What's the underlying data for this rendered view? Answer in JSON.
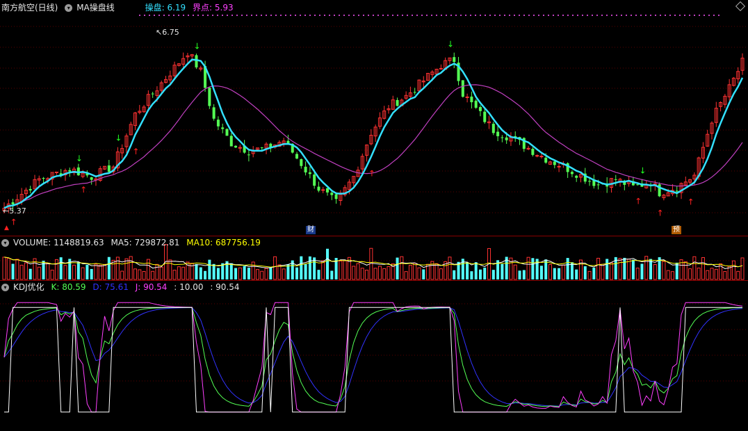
{
  "main": {
    "stock_name": "南方航空(日线)",
    "indicator_name": "MA操盘线",
    "caopan_label": "操盘: ",
    "caopan_value": "6.19",
    "jiedian_label": "界点: ",
    "jiedian_value": "5.93",
    "high_label": "6.75",
    "low_label": "5.37",
    "marker_cai": "财",
    "marker_yu": "预"
  },
  "volume": {
    "label": "VOLUME: 1148819.63",
    "ma5": "MA5: 729872.81",
    "ma10": "MA10: 687756.19"
  },
  "kdj": {
    "name": "KDJ优化",
    "k": "K: 80.59",
    "d": "D: 75.61",
    "j": "J: 90.54",
    "v1": ": 10.00",
    "v2": ": 90.54"
  },
  "colors": {
    "up": "#ff3232",
    "down": "#54ff54",
    "ma_cyan": "#33e0ff",
    "ma_magenta": "#c040c0",
    "kdj_k": "#54ff54",
    "kdj_d": "#3232ff",
    "kdj_j": "#ff40ff",
    "vol_up": "#ff3232",
    "vol_down": "#54ffff",
    "ma5_line": "#ffffff",
    "ma10_line": "#ffff00"
  },
  "chart_data": {
    "type": "candlestick",
    "price_ylim": [
      5.3,
      6.85
    ],
    "anchors": [
      [
        0,
        5.4
      ],
      [
        8,
        5.62
      ],
      [
        15,
        5.7
      ],
      [
        20,
        5.64
      ],
      [
        25,
        5.72
      ],
      [
        30,
        6.12
      ],
      [
        35,
        6.32
      ],
      [
        40,
        6.52
      ],
      [
        42,
        6.6
      ],
      [
        45,
        6.45
      ],
      [
        48,
        6.08
      ],
      [
        52,
        5.9
      ],
      [
        56,
        5.84
      ],
      [
        60,
        5.86
      ],
      [
        64,
        5.92
      ],
      [
        68,
        5.74
      ],
      [
        72,
        5.55
      ],
      [
        76,
        5.44
      ],
      [
        80,
        5.64
      ],
      [
        84,
        5.98
      ],
      [
        88,
        6.18
      ],
      [
        92,
        6.26
      ],
      [
        96,
        6.38
      ],
      [
        100,
        6.5
      ],
      [
        103,
        6.54
      ],
      [
        105,
        6.28
      ],
      [
        108,
        6.16
      ],
      [
        112,
        6.0
      ],
      [
        116,
        5.94
      ],
      [
        120,
        5.86
      ],
      [
        124,
        5.78
      ],
      [
        128,
        5.72
      ],
      [
        132,
        5.65
      ],
      [
        136,
        5.58
      ],
      [
        140,
        5.62
      ],
      [
        144,
        5.56
      ],
      [
        148,
        5.6
      ],
      [
        150,
        5.52
      ],
      [
        154,
        5.56
      ],
      [
        158,
        5.65
      ],
      [
        162,
        6.08
      ],
      [
        166,
        6.32
      ],
      [
        169,
        6.52
      ]
    ]
  }
}
